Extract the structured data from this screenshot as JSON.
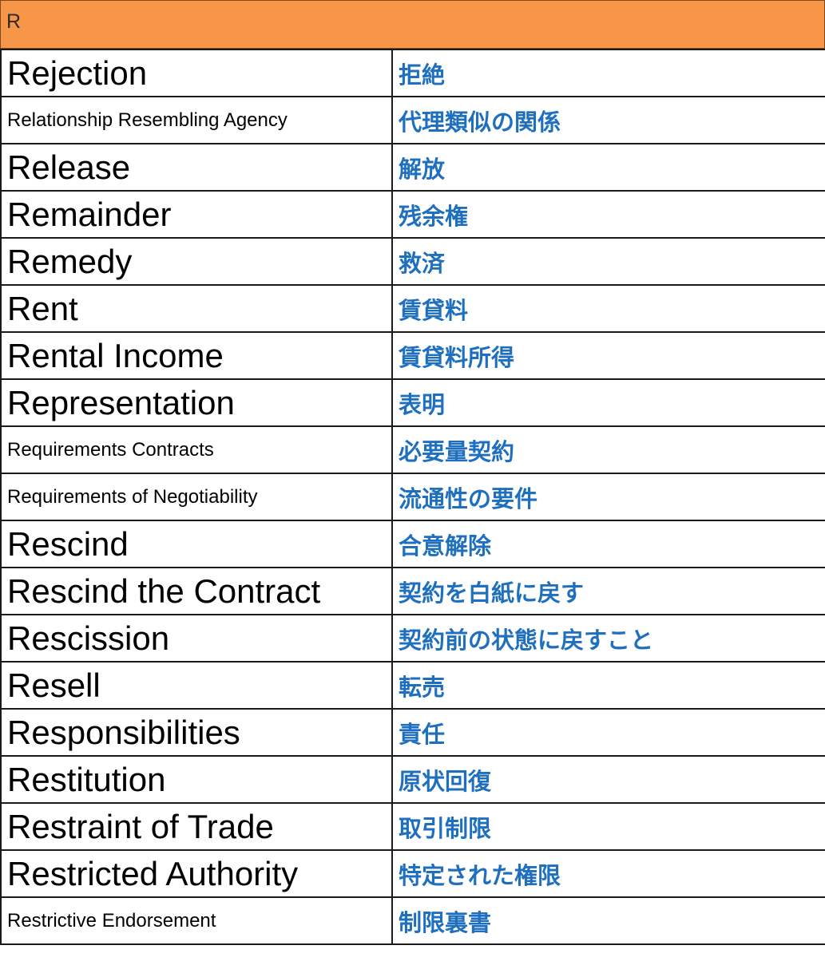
{
  "header": {
    "letter": "R"
  },
  "rows": [
    {
      "en": "Rejection",
      "ja": "拒絶",
      "size": "l"
    },
    {
      "en": "Relationship Resembling Agency",
      "ja": "代理類似の関係",
      "size": "s"
    },
    {
      "en": "Release",
      "ja": "解放",
      "size": "l"
    },
    {
      "en": "Remainder",
      "ja": "残余権",
      "size": "l"
    },
    {
      "en": "Remedy",
      "ja": "救済",
      "size": "l"
    },
    {
      "en": "Rent",
      "ja": "賃貸料",
      "size": "l"
    },
    {
      "en": "Rental Income",
      "ja": "賃貸料所得",
      "size": "l"
    },
    {
      "en": "Representation",
      "ja": "表明",
      "size": "l"
    },
    {
      "en": "Requirements Contracts",
      "ja": "必要量契約",
      "size": "s"
    },
    {
      "en": "Requirements of Negotiability",
      "ja": "流通性の要件",
      "size": "s"
    },
    {
      "en": "Rescind",
      "ja": "合意解除",
      "size": "l"
    },
    {
      "en": "Rescind the Contract",
      "ja": "契約を白紙に戻す",
      "size": "l"
    },
    {
      "en": "Rescission",
      "ja": "契約前の状態に戻すこと",
      "size": "l"
    },
    {
      "en": "Resell",
      "ja": "転売",
      "size": "l"
    },
    {
      "en": "Responsibilities",
      "ja": "責任",
      "size": "l"
    },
    {
      "en": "Restitution",
      "ja": "原状回復",
      "size": "l"
    },
    {
      "en": "Restraint of Trade",
      "ja": "取引制限",
      "size": "l"
    },
    {
      "en": "Restricted Authority",
      "ja": "特定された権限",
      "size": "l"
    },
    {
      "en": "Restrictive Endorsement",
      "ja": "制限裏書",
      "size": "s"
    }
  ]
}
